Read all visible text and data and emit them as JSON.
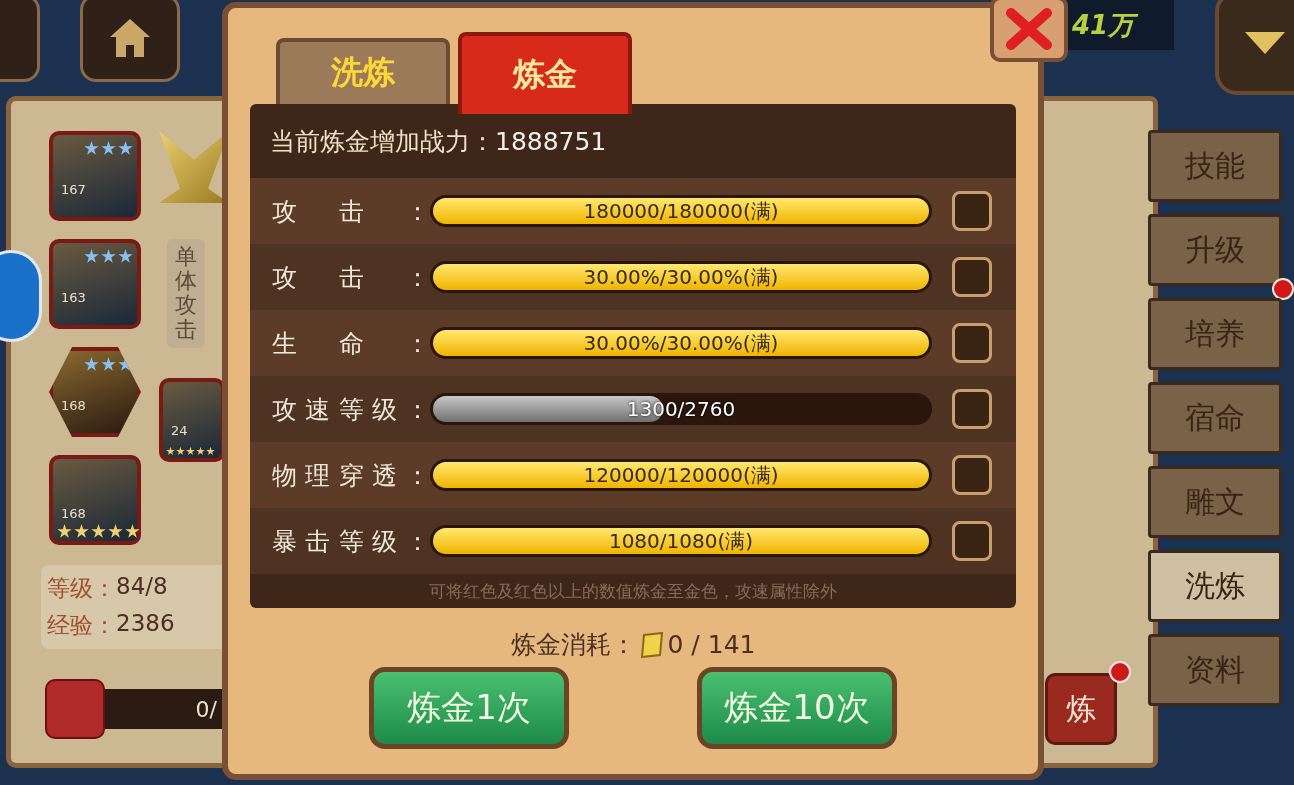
{
  "top_bar": {
    "currency": "41万"
  },
  "left_panel": {
    "items": [
      {
        "level": "167",
        "stars": 3,
        "kind": "square"
      },
      {
        "level": "163",
        "stars": 3,
        "kind": "square"
      },
      {
        "level": "168",
        "stars": 3,
        "kind": "hexagon"
      },
      {
        "level": "168",
        "stars": 5,
        "kind": "square"
      }
    ],
    "side_item": {
      "level": "24",
      "stars": 5
    },
    "skill_label": "单体攻击",
    "stats": [
      {
        "label": "等级：",
        "value": "84/8"
      },
      {
        "label": "经验：",
        "value": "2386"
      }
    ],
    "progress": {
      "level": 0,
      "value": "0/"
    }
  },
  "side_tabs": [
    {
      "label": "技能",
      "selected": false,
      "badge": false
    },
    {
      "label": "升级",
      "selected": false,
      "badge": true
    },
    {
      "label": "培养",
      "selected": false,
      "badge": false
    },
    {
      "label": "宿命",
      "selected": false,
      "badge": false
    },
    {
      "label": "雕文",
      "selected": false,
      "badge": false
    },
    {
      "label": "洗炼",
      "selected": true,
      "badge": false
    },
    {
      "label": "资料",
      "selected": false,
      "badge": false
    }
  ],
  "right_panel": {
    "button_label": "炼",
    "button_badge": true
  },
  "dialog": {
    "tabs": [
      {
        "label": "洗炼",
        "selected": false
      },
      {
        "label": "炼金",
        "selected": true
      }
    ],
    "power_label": "当前炼金增加战力：",
    "power_value": "1888751",
    "attributes": [
      {
        "label": "攻击：",
        "reading": "180000/180000(满)",
        "level": 1,
        "checked": false
      },
      {
        "label": "攻击：",
        "reading": "30.00%/30.00%(满)",
        "level": 1,
        "checked": false
      },
      {
        "label": "生命：",
        "reading": "30.00%/30.00%(满)",
        "level": 1,
        "checked": false
      },
      {
        "label": "攻速等级：",
        "reading": "1300/2760",
        "level": 0.47,
        "checked": false
      },
      {
        "label": "物理穿透：",
        "reading": "120000/120000(满)",
        "level": 1,
        "checked": false
      },
      {
        "label": "暴击等级：",
        "reading": "1080/1080(满)",
        "level": 1,
        "checked": false
      }
    ],
    "note": "可将红色及红色以上的数值炼金至金色，攻速属性除外",
    "cost_label": "炼金消耗：",
    "cost_value": "0 / 141",
    "buttons": [
      "炼金1次",
      "炼金10次"
    ]
  }
}
